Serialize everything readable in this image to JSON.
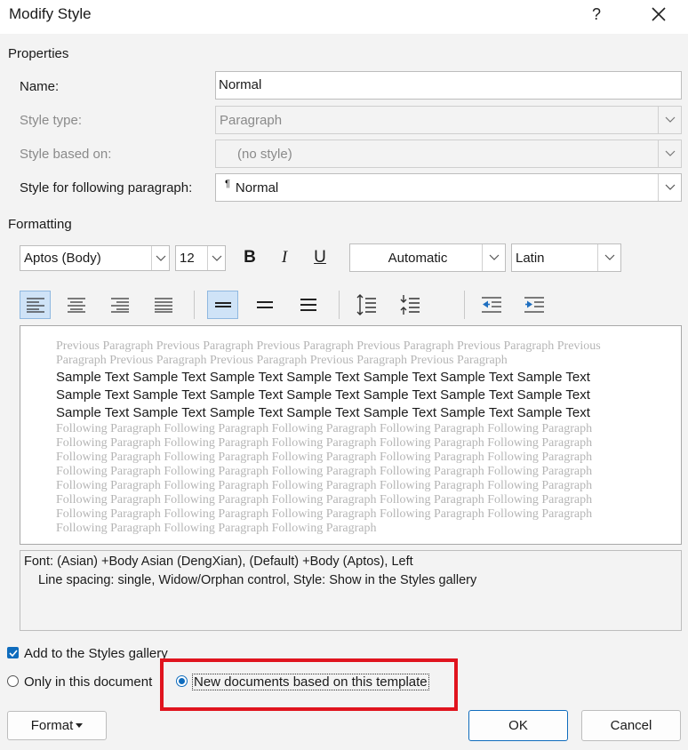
{
  "window": {
    "title": "Modify Style",
    "help_label": "?",
    "close_label": "✕"
  },
  "properties": {
    "header": "Properties",
    "name_label": "Name:",
    "name_value": "Normal",
    "style_type_label": "Style type:",
    "style_type_value": "Paragraph",
    "based_on_label": "Style based on:",
    "based_on_value": "(no style)",
    "following_label": "Style for following paragraph:",
    "following_value": "Normal",
    "following_icon": "¶"
  },
  "formatting": {
    "header": "Formatting",
    "font": "Aptos (Body)",
    "size": "12",
    "bold": "B",
    "italic": "I",
    "underline": "U",
    "color": "Automatic",
    "script": "Latin"
  },
  "preview": {
    "previous": "Previous Paragraph Previous Paragraph Previous Paragraph Previous Paragraph Previous Paragraph Previous Paragraph Previous Paragraph Previous Paragraph Previous Paragraph Previous Paragraph",
    "sample_lines": [
      "Sample Text Sample Text Sample Text Sample Text Sample Text Sample Text Sample Text",
      "Sample Text Sample Text Sample Text Sample Text Sample Text Sample Text Sample Text",
      "Sample Text Sample Text Sample Text Sample Text Sample Text Sample Text Sample Text"
    ],
    "following_lines": [
      "Following Paragraph Following Paragraph Following Paragraph Following Paragraph Following Paragraph",
      "Following Paragraph Following Paragraph Following Paragraph Following Paragraph Following Paragraph",
      "Following Paragraph Following Paragraph Following Paragraph Following Paragraph Following Paragraph",
      "Following Paragraph Following Paragraph Following Paragraph Following Paragraph Following Paragraph",
      "Following Paragraph Following Paragraph Following Paragraph Following Paragraph Following Paragraph",
      "Following Paragraph Following Paragraph Following Paragraph Following Paragraph Following Paragraph",
      "Following Paragraph Following Paragraph Following Paragraph Following Paragraph Following Paragraph",
      "Following Paragraph Following Paragraph Following Paragraph"
    ]
  },
  "description": {
    "line1": "Font: (Asian) +Body Asian (DengXian), (Default) +Body (Aptos), Left",
    "line2": "Line spacing:  single, Widow/Orphan control, Style: Show in the Styles gallery"
  },
  "options": {
    "add_to_gallery": "Add to the Styles gallery",
    "add_to_gallery_checked": true,
    "only_this_document": "Only in this document",
    "new_documents": "New documents based on this template"
  },
  "buttons": {
    "format": "Format",
    "ok": "OK",
    "cancel": "Cancel"
  },
  "colors": {
    "accent": "#0f6cbd",
    "highlight": "#e0141e",
    "active_tool": "#cfe3f7"
  }
}
